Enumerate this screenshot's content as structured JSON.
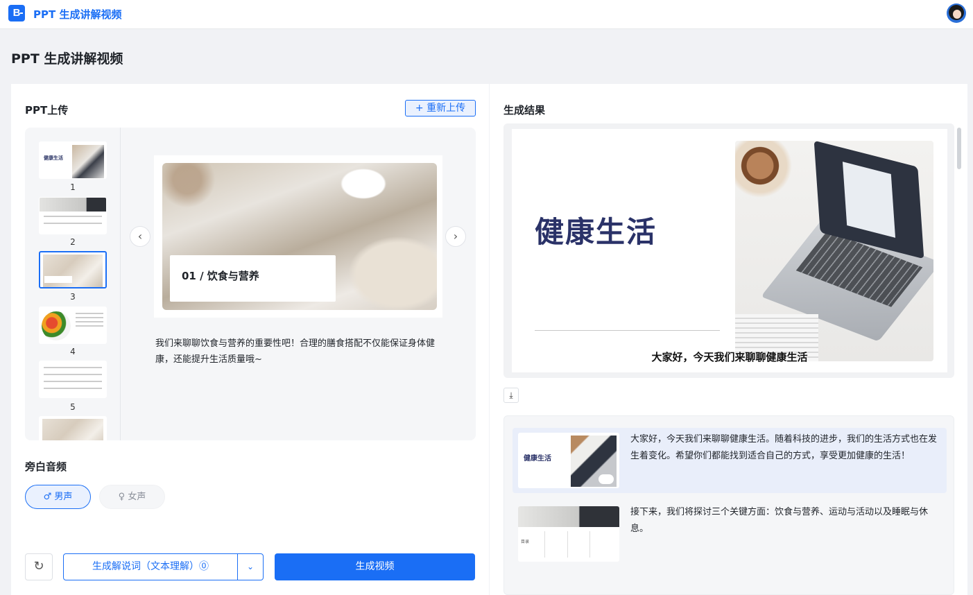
{
  "app": {
    "logo_letter": "B",
    "title": "PPT 生成讲解视频"
  },
  "page": {
    "title": "PPT 生成讲解视频"
  },
  "upload": {
    "heading": "PPT上传",
    "reupload_label": "+ 重新上传",
    "thumbnails": [
      {
        "number": "1",
        "title": "健康生活"
      },
      {
        "number": "2"
      },
      {
        "number": "3",
        "selected": true
      },
      {
        "number": "4"
      },
      {
        "number": "5"
      }
    ],
    "preview": {
      "slide_label": "01 / 饮食与营养",
      "narration": "我们来聊聊饮食与营养的重要性吧！合理的膳食搭配不仅能保证身体健康，还能提升生活质量哦~"
    },
    "nav": {
      "prev_icon": "‹",
      "next_icon": "›"
    }
  },
  "audio": {
    "heading": "旁白音频",
    "male_label": "♂ 男声",
    "female_label": "♀ 女声",
    "selected": "male"
  },
  "actions": {
    "reset_icon": "↻",
    "generate_script_label": "生成解说词（文本理解）⓪",
    "dropdown_icon": "⌄",
    "generate_video_label": "生成视频"
  },
  "result": {
    "heading": "生成结果",
    "video": {
      "slide_title": "健康生活",
      "subtitle": "大家好，今天我们来聊聊健康生活"
    },
    "download_icon": "⤓",
    "items": [
      {
        "thumb_title": "健康生活",
        "text": "大家好，今天我们来聊聊健康生活。随着科技的进步，我们的生活方式也在发生着变化。希望你们都能找到适合自己的方式，享受更加健康的生活！",
        "active": true
      },
      {
        "thumb_label": "目录",
        "text": "接下来，我们将探讨三个关键方面：饮食与营养、运动与活动以及睡眠与休息。",
        "active": false
      }
    ]
  },
  "colors": {
    "accent": "#1a6ef5",
    "title_navy": "#2a3268"
  }
}
